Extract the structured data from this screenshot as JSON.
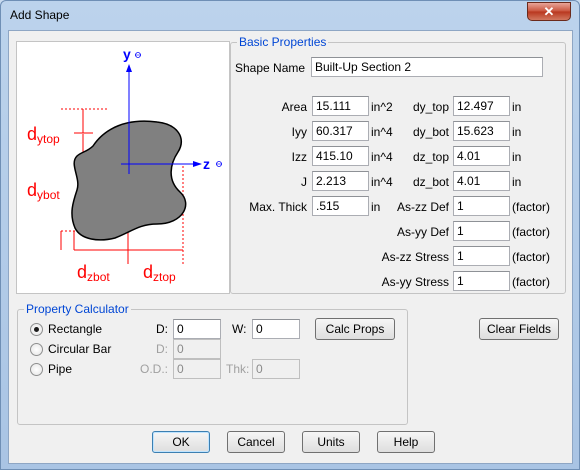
{
  "window": {
    "title": "Add Shape",
    "close_glyph": "✕"
  },
  "diagram": {
    "y_axis": "y",
    "z_axis": "z",
    "dytop": {
      "main": "d",
      "sub": "ytop"
    },
    "dybot": {
      "main": "d",
      "sub": "ybot"
    },
    "dzbot": {
      "main": "d",
      "sub": "zbot"
    },
    "dztop": {
      "main": "d",
      "sub": "ztop"
    },
    "colors": {
      "axis": "#0000ff",
      "dim": "#ff0000",
      "shape_fill": "#808080"
    }
  },
  "basic": {
    "legend": "Basic Properties",
    "shape_name_label": "Shape Name",
    "shape_name_value": "Built-Up Section 2",
    "left_rows": [
      {
        "label": "Area",
        "value": "15.111",
        "unit": "in^2"
      },
      {
        "label": "Iyy",
        "value": "60.317",
        "unit": "in^4"
      },
      {
        "label": "Izz",
        "value": "415.10",
        "unit": "in^4"
      },
      {
        "label": "J",
        "value": "2.213",
        "unit": "in^4"
      },
      {
        "label": "Max. Thick",
        "value": ".515",
        "unit": "in"
      }
    ],
    "right_rows": [
      {
        "label": "dy_top",
        "value": "12.497",
        "unit": "in"
      },
      {
        "label": "dy_bot",
        "value": "15.623",
        "unit": "in"
      },
      {
        "label": "dz_top",
        "value": "4.01",
        "unit": "in"
      },
      {
        "label": "dz_bot",
        "value": "4.01",
        "unit": "in"
      },
      {
        "label": "As-zz Def",
        "value": "1",
        "unit": "(factor)"
      },
      {
        "label": "As-yy Def",
        "value": "1",
        "unit": "(factor)"
      },
      {
        "label": "As-zz Stress",
        "value": "1",
        "unit": "(factor)"
      },
      {
        "label": "As-yy Stress",
        "value": "1",
        "unit": "(factor)"
      }
    ]
  },
  "calculator": {
    "legend": "Property Calculator",
    "options": [
      {
        "label": "Rectangle",
        "selected": true
      },
      {
        "label": "Circular Bar",
        "selected": false
      },
      {
        "label": "Pipe",
        "selected": false
      }
    ],
    "d_label": "D:",
    "d_value": "0",
    "w_label": "W:",
    "w_value": "0",
    "d2_label": "D:",
    "d2_value": "0",
    "od_label": "O.D.:",
    "od_value": "0",
    "thk_label": "Thk:",
    "thk_value": "0",
    "calc_button": "Calc Props"
  },
  "clear_button": "Clear Fields",
  "footer": {
    "ok": "OK",
    "cancel": "Cancel",
    "units": "Units",
    "help": "Help"
  }
}
